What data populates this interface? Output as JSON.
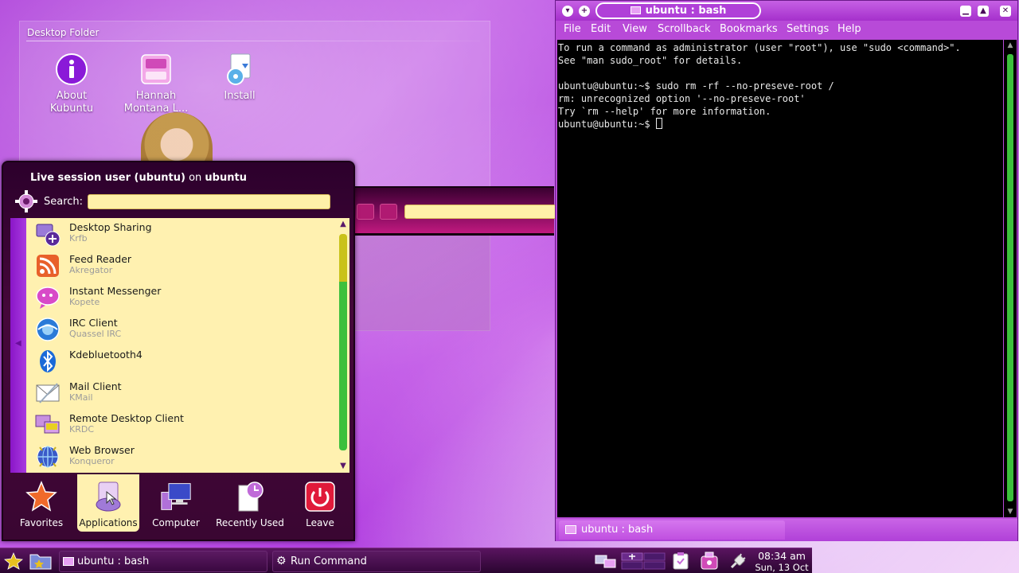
{
  "desktop_folder": {
    "title": "Desktop Folder",
    "icons": [
      {
        "label": "About Kubuntu",
        "icon": "info-icon"
      },
      {
        "label": "Hannah Montana L...",
        "icon": "hannah-montana-icon"
      },
      {
        "label": "Install",
        "icon": "install-icon"
      }
    ]
  },
  "kickoff": {
    "user_label": "Live session user (ubuntu)",
    "on_word": "on",
    "host": "ubuntu",
    "search_label": "Search:",
    "search_value": "",
    "apps": [
      {
        "name": "Desktop Sharing",
        "sub": "Krfb"
      },
      {
        "name": "Feed Reader",
        "sub": "Akregator"
      },
      {
        "name": "Instant Messenger",
        "sub": "Kopete"
      },
      {
        "name": "IRC Client",
        "sub": "Quassel IRC"
      },
      {
        "name": "Kdebluetooth4",
        "sub": ""
      },
      {
        "name": "Mail Client",
        "sub": "KMail"
      },
      {
        "name": "Remote Desktop Client",
        "sub": "KRDC"
      },
      {
        "name": "Web Browser",
        "sub": "Konqueror"
      }
    ],
    "tabs": [
      {
        "label": "Favorites"
      },
      {
        "label": "Applications"
      },
      {
        "label": "Computer"
      },
      {
        "label": "Recently Used"
      },
      {
        "label": "Leave"
      }
    ],
    "active_tab": "Applications"
  },
  "konsole": {
    "title": "ubuntu : bash",
    "menus": [
      "File",
      "Edit",
      "View",
      "Scrollback",
      "Bookmarks",
      "Settings",
      "Help"
    ],
    "lines": [
      "To run a command as administrator (user \"root\"), use \"sudo <command>\".",
      "See \"man sudo_root\" for details.",
      "",
      "ubuntu@ubuntu:~$ sudo rm -rf --no-preseve-root /",
      "rm: unrecognized option '--no-preseve-root'",
      "Try `rm --help' for more information."
    ],
    "prompt": "ubuntu@ubuntu:~$ ",
    "tab_label": "ubuntu : bash"
  },
  "taskbar": {
    "tasks": [
      {
        "label": "ubuntu : bash"
      },
      {
        "label": "Run Command"
      }
    ],
    "clock_time": "08:34 am",
    "clock_date": "Sun, 13 Oct"
  },
  "colors": {
    "accent": "#b84ad8",
    "list_bg": "#fff1b0",
    "panel": "#2a0530"
  }
}
